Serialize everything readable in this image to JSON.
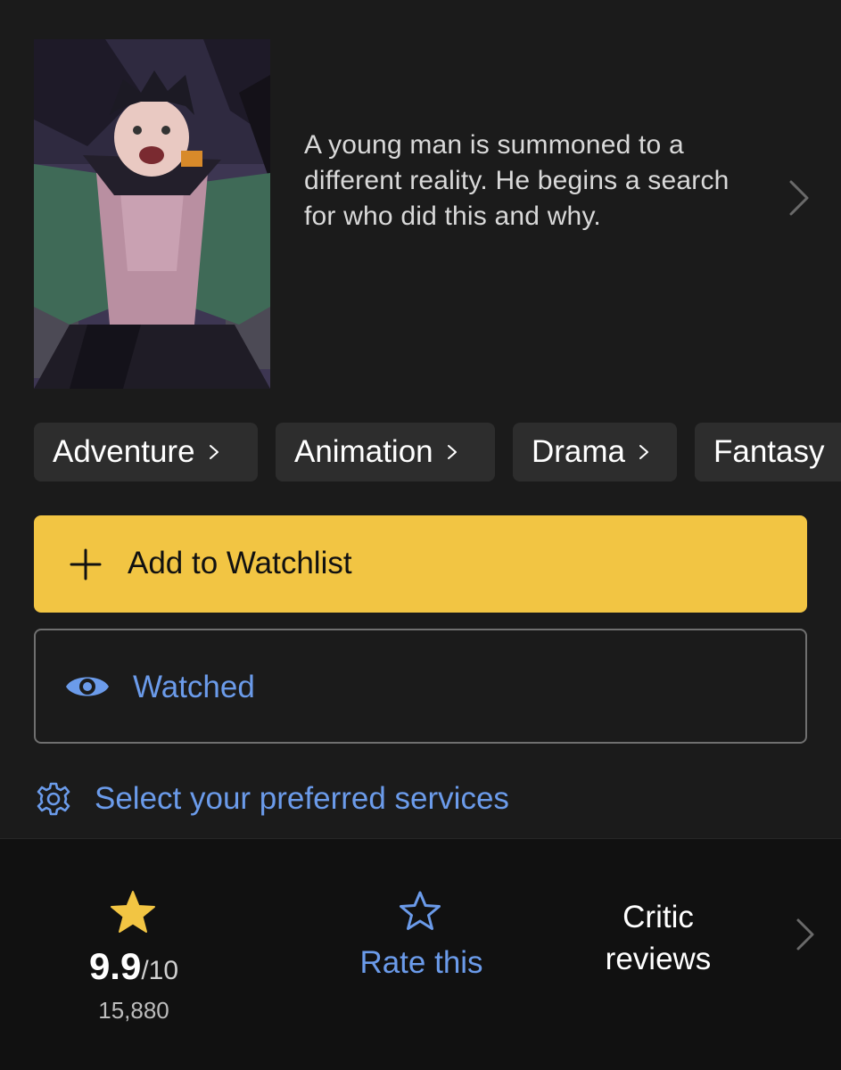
{
  "description": "A young man is summoned to a different reality. He begins a search for who did this and why.",
  "genres": [
    "Adventure",
    "Animation",
    "Drama",
    "Fantasy"
  ],
  "actions": {
    "watchlist_label": "Add to Watchlist",
    "watched_label": "Watched",
    "services_label": "Select your preferred services"
  },
  "ratings": {
    "score": "9.9",
    "out_of": "/10",
    "count": "15,880",
    "rate_label": "Rate this",
    "critic_line1": "Critic",
    "critic_line2": "reviews"
  },
  "colors": {
    "background": "#1b1b1b",
    "accent_yellow": "#f2c543",
    "link_blue": "#6b9bea",
    "chip_bg": "#2d2d2d"
  },
  "icons": [
    "chevron-right-icon",
    "plus-icon",
    "eye-icon",
    "gear-icon",
    "star-filled-icon",
    "star-outline-icon"
  ]
}
